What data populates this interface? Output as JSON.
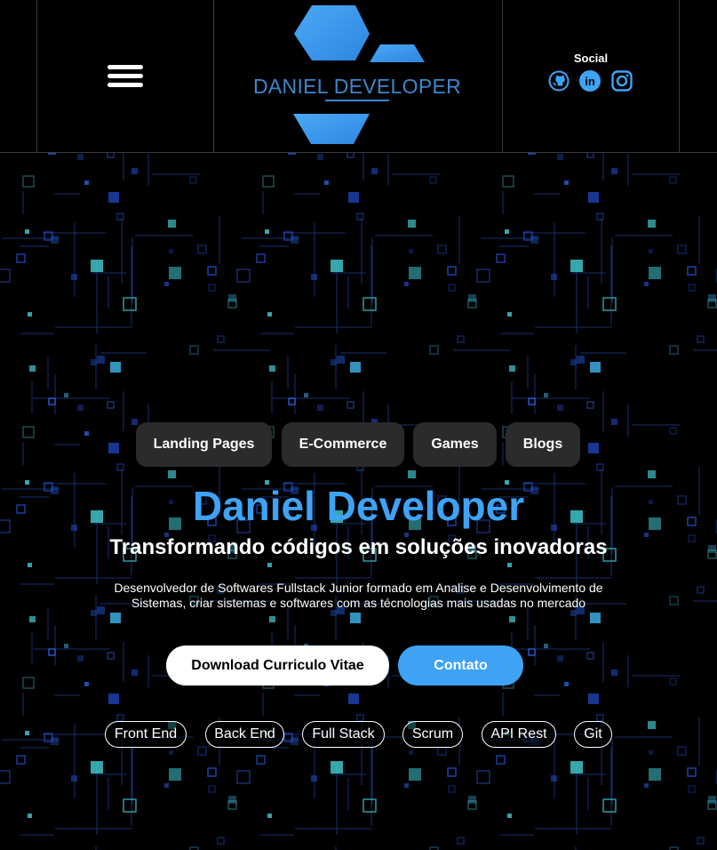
{
  "header": {
    "menu_label": "menu",
    "logo": {
      "text": "DANIEL DEVELOPER",
      "color": "#3b87cc",
      "hex_color": "#3ea3f5"
    },
    "social": {
      "title": "Social",
      "links": [
        {
          "icon": "github-icon"
        },
        {
          "icon": "linkedin-icon",
          "text": "in"
        },
        {
          "icon": "instagram-icon"
        }
      ]
    }
  },
  "hero": {
    "tags": [
      "Landing Pages",
      "E-Commerce",
      "Games",
      "Blogs"
    ],
    "title": "Daniel Developer",
    "subtitle": "Transformando códigos em soluções inovadoras",
    "description": "Desenvolvedor de Softwares Fullstack Junior formado em Analise e Desenvolvimento de Sistemas, criar sistemas e softwares com as técnologias mais usadas no mercado",
    "buttons": {
      "cv": "Download Curriculo Vitae",
      "contact": "Contato"
    },
    "skills": [
      "Front End",
      "Back End",
      "Full Stack",
      "Scrum",
      "API Rest",
      "Git"
    ]
  },
  "colors": {
    "accent": "#3ea3f5",
    "background": "#000000",
    "tag_bg": "#2b2b2b",
    "circuit": "#1a3f8f"
  }
}
